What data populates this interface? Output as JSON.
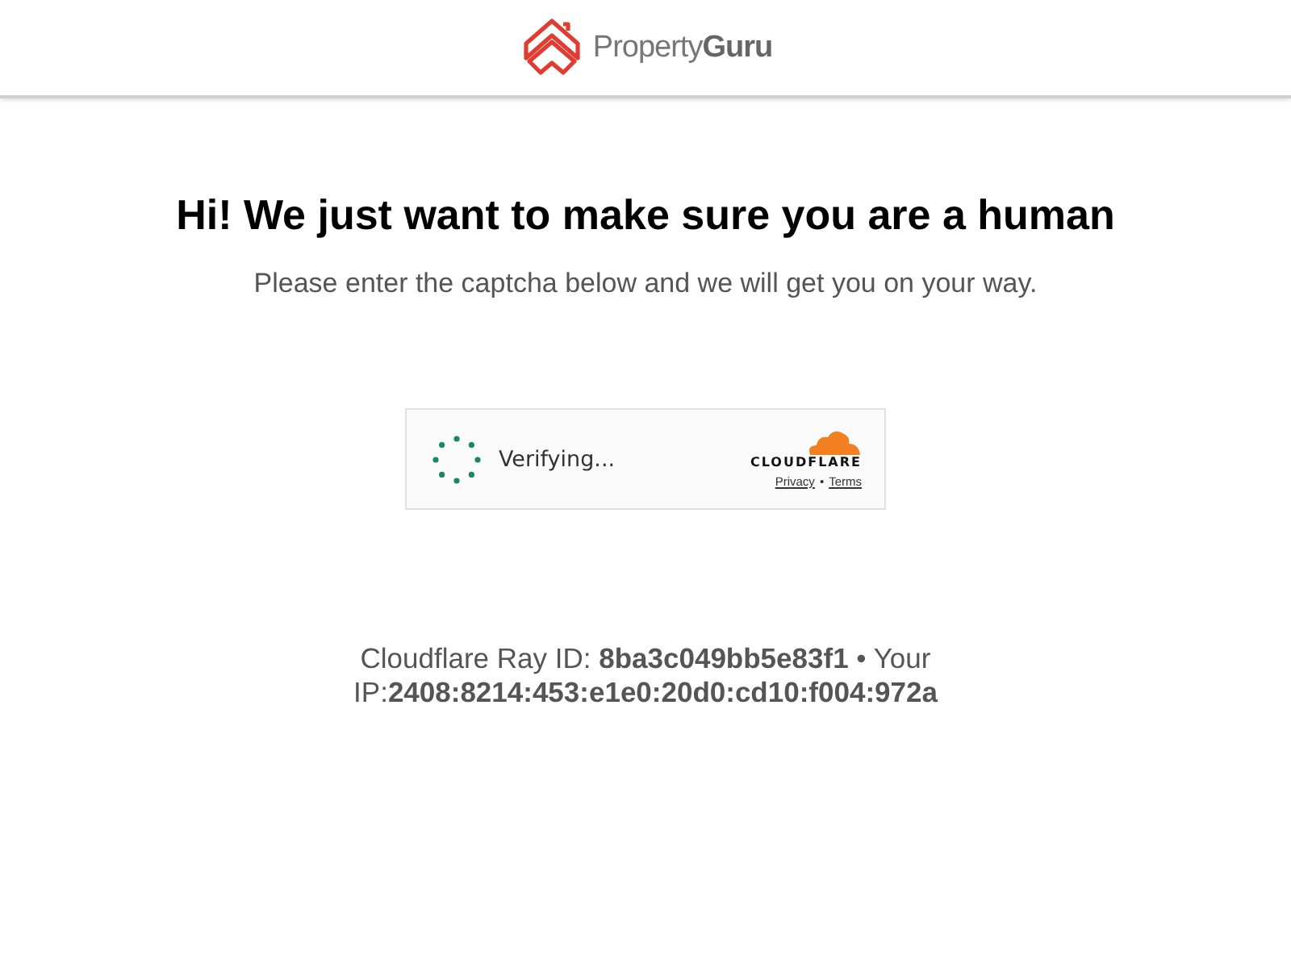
{
  "header": {
    "brand": "Property**Guru**"
  },
  "heading": "Hi! We just want to make sure you are a human",
  "subheading": "Please enter the captcha below and we will get you on your way.",
  "captcha": {
    "status": "Verifying...",
    "provider": "CLOUDFLARE",
    "links": [
      "Privacy",
      "Terms"
    ],
    "separator": "•"
  },
  "footer": "Cloudflare Ray ID: **8ba3c049bb5e83f1** • Your IP:**2408:8214:453:e1e0:20d0:cd10:f004:972a**"
}
